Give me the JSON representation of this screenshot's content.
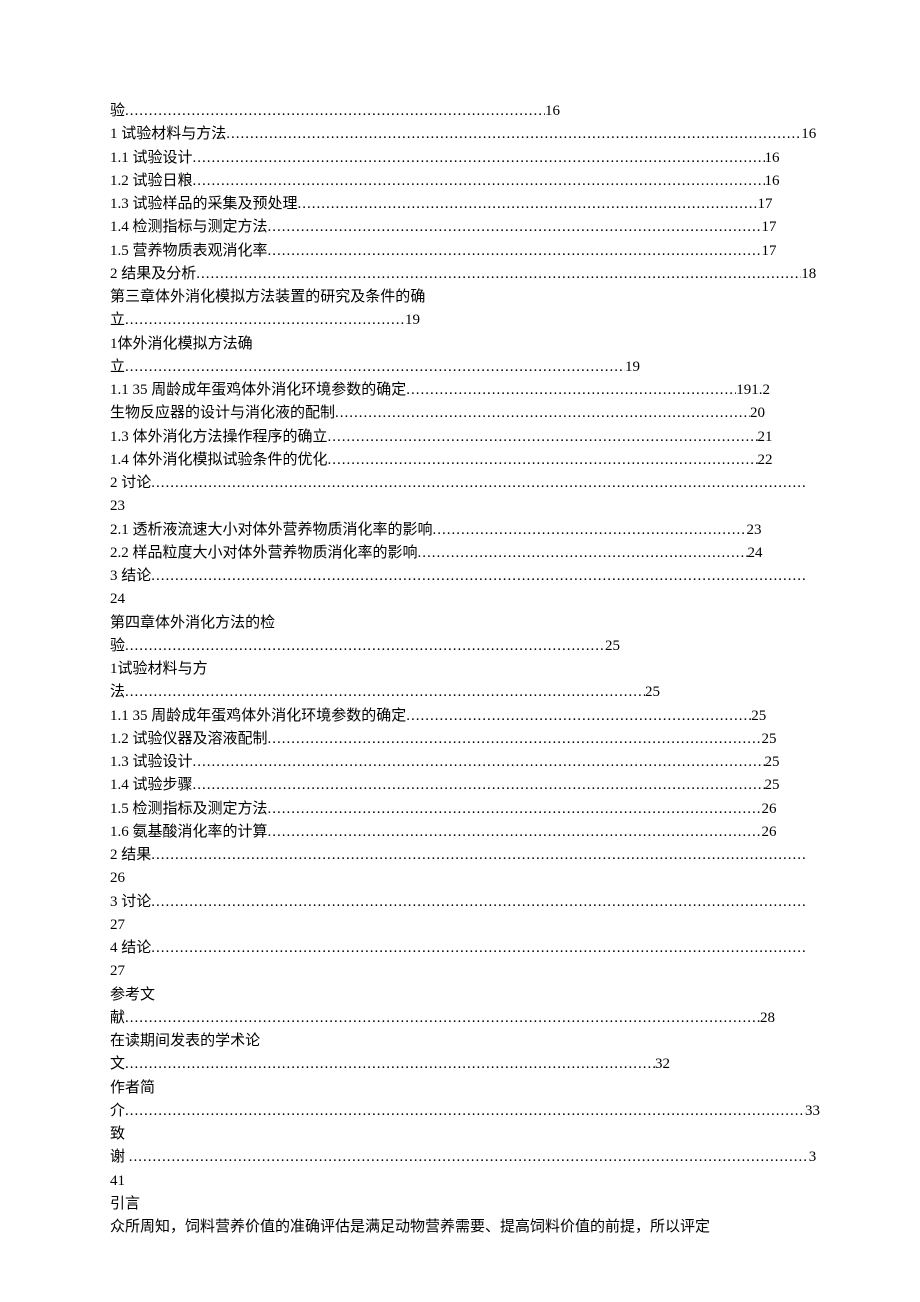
{
  "toc": {
    "entries": [
      {
        "type": "leader",
        "title": "验",
        "page": "16",
        "indent": 0,
        "leaderWidth": 420
      },
      {
        "type": "leader",
        "title": "1 试验材料与方法",
        "page": "16",
        "indent": 0,
        "leaderWidth": 575
      },
      {
        "type": "leader",
        "title": "1.1 试验设计",
        "page": "16",
        "indent": 0,
        "leaderWidth": 572
      },
      {
        "type": "leader",
        "title": "1.2 试验日粮",
        "page": "16",
        "indent": 0,
        "leaderWidth": 572
      },
      {
        "type": "leader",
        "title": "1.3 试验样品的采集及预处理",
        "page": "17",
        "indent": 0,
        "leaderWidth": 460
      },
      {
        "type": "leader",
        "title": "1.4 检测指标与测定方法",
        "page": "17",
        "indent": 0,
        "leaderWidth": 494
      },
      {
        "type": "leader",
        "title": "1.5 营养物质表观消化率",
        "page": "17",
        "indent": 0,
        "leaderWidth": 494
      },
      {
        "type": "leader",
        "title": "2 结果及分析",
        "page": "18",
        "indent": 0,
        "leaderWidth": 605
      },
      {
        "type": "spread",
        "text": "第三章体外消化模拟方法装置的研究及条件的确"
      },
      {
        "type": "cont-leader",
        "title": "立",
        "page": "19",
        "leaderWidth": 280
      },
      {
        "type": "spread",
        "text": "1体外消化模拟方法确"
      },
      {
        "type": "cont-leader-noright",
        "title": "立",
        "page": "19",
        "leaderWidth": 500
      },
      {
        "type": "merged",
        "title1": "1.1 35 周龄成年蛋鸡体外消化环境参数的确定",
        "page1": "19",
        "leader1": 330,
        "title2": "1.2"
      },
      {
        "type": "leader",
        "title": "生物反应器的设计与消化液的配制",
        "page": "20",
        "indent": 0,
        "leaderWidth": 415
      },
      {
        "type": "leader",
        "title": "1.3 体外消化方法操作程序的确立",
        "page": "21",
        "indent": 0,
        "leaderWidth": 430
      },
      {
        "type": "leader",
        "title": "1.4 体外消化模拟试验条件的优化",
        "page": "22",
        "indent": 0,
        "leaderWidth": 430
      },
      {
        "type": "leader",
        "title": "2 讨论",
        "page": "23",
        "indent": 0,
        "leaderWidth": 654
      },
      {
        "type": "leader",
        "title": "2.1 透析液流速大小对体外营养物质消化率的影响",
        "page": "23",
        "indent": 0,
        "leaderWidth": 314
      },
      {
        "type": "leader",
        "title": "2.2 样品粒度大小对体外营养物质消化率的影响",
        "page": "24",
        "indent": 0,
        "leaderWidth": 330
      },
      {
        "type": "leader",
        "title": "3 结论",
        "page": "24",
        "indent": 0,
        "leaderWidth": 654
      },
      {
        "type": "spread",
        "text": "第四章体外消化方法的检"
      },
      {
        "type": "cont-leader-noright",
        "title": "验",
        "page": "25",
        "leaderWidth": 480
      },
      {
        "type": "spread",
        "text": "1试验材料与方"
      },
      {
        "type": "cont-leader-noright",
        "title": "法",
        "page": "25",
        "leaderWidth": 520
      },
      {
        "type": "leader",
        "title": "1.1 35 周龄成年蛋鸡体外消化环境参数的确定",
        "page": "25",
        "indent": 0,
        "leaderWidth": 345
      },
      {
        "type": "leader",
        "title": "1.2 试验仪器及溶液配制",
        "page": "25",
        "indent": 0,
        "leaderWidth": 494
      },
      {
        "type": "leader",
        "title": "1.3 试验设计",
        "page": "25",
        "indent": 0,
        "leaderWidth": 572
      },
      {
        "type": "leader",
        "title": "1.4 试验步骤",
        "page": "25",
        "indent": 0,
        "leaderWidth": 572
      },
      {
        "type": "leader",
        "title": "1.5 检测指标及测定方法",
        "page": "26",
        "indent": 0,
        "leaderWidth": 494
      },
      {
        "type": "leader",
        "title": "1.6 氨基酸消化率的计算",
        "page": "26",
        "indent": 0,
        "leaderWidth": 494
      },
      {
        "type": "leader",
        "title": "2 结果",
        "page": "26",
        "indent": 0,
        "leaderWidth": 654
      },
      {
        "type": "leader",
        "title": "3 讨论",
        "page": "27",
        "indent": 0,
        "leaderWidth": 654
      },
      {
        "type": "leader",
        "title": "4 结论",
        "page": "27",
        "indent": 0,
        "leaderWidth": 654
      },
      {
        "type": "spread",
        "text": "参考文"
      },
      {
        "type": "cont-leader-noright",
        "title": "献",
        "page": "28",
        "leaderWidth": 635
      },
      {
        "type": "spread",
        "text": "在读期间发表的学术论"
      },
      {
        "type": "cont-leader-noright",
        "title": "文",
        "page": "32",
        "leaderWidth": 530
      },
      {
        "type": "spread",
        "text": "作者简"
      },
      {
        "type": "cont-leader-noright",
        "title": "介",
        "page": "33",
        "leaderWidth": 680
      },
      {
        "type": "plain",
        "text": "致"
      },
      {
        "type": "leader-noright-wide",
        "title": "谢",
        "page": "3",
        "leaderWidth": 680
      },
      {
        "type": "plain",
        "text": "41"
      }
    ]
  },
  "body": {
    "heading": "引言",
    "para1": "众所周知，饲料营养价值的准确评估是满足动物营养需要、提高饲料价值的前提，所以评定"
  }
}
